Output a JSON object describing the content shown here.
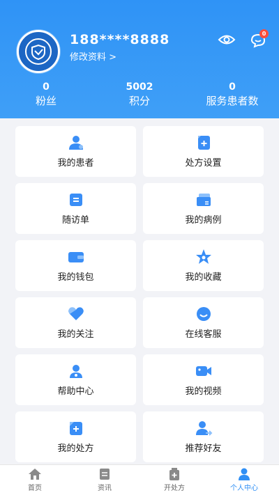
{
  "profile": {
    "username": "188****8888",
    "edit_label": "修改资料 >",
    "message_badge": "0"
  },
  "stats": [
    {
      "value": "0",
      "label": "粉丝"
    },
    {
      "value": "5002",
      "label": "积分"
    },
    {
      "value": "0",
      "label": "服务患者数"
    }
  ],
  "menu": [
    {
      "label": "我的患者",
      "icon": "patient-icon"
    },
    {
      "label": "处方设置",
      "icon": "prescription-settings-icon"
    },
    {
      "label": "随访单",
      "icon": "followup-form-icon"
    },
    {
      "label": "我的病例",
      "icon": "medical-record-icon"
    },
    {
      "label": "我的钱包",
      "icon": "wallet-icon"
    },
    {
      "label": "我的收藏",
      "icon": "favorite-star-icon"
    },
    {
      "label": "我的关注",
      "icon": "follow-heart-icon"
    },
    {
      "label": "在线客服",
      "icon": "customer-service-icon"
    },
    {
      "label": "帮助中心",
      "icon": "help-center-icon"
    },
    {
      "label": "我的视频",
      "icon": "video-icon"
    },
    {
      "label": "我的处方",
      "icon": "my-prescription-icon"
    },
    {
      "label": "推荐好友",
      "icon": "recommend-friend-icon"
    }
  ],
  "tabs": [
    {
      "label": "首页",
      "icon": "home-icon"
    },
    {
      "label": "资讯",
      "icon": "news-icon"
    },
    {
      "label": "开处方",
      "icon": "prescribe-icon"
    },
    {
      "label": "个人中心",
      "icon": "profile-icon"
    }
  ],
  "colors": {
    "primary": "#2f93f6",
    "icon_blue": "#3a8ef6",
    "badge": "#ff4d3a"
  }
}
